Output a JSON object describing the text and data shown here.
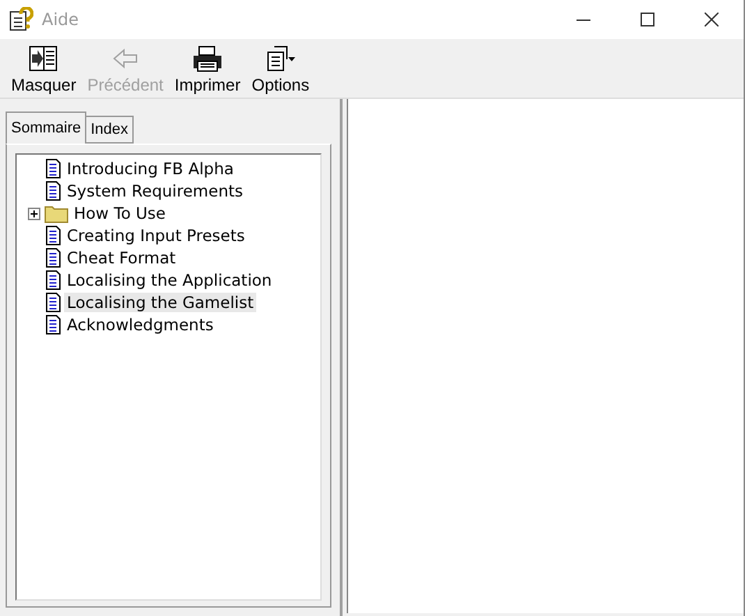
{
  "window": {
    "title": "Aide"
  },
  "toolbar": [
    {
      "kind": "hide",
      "label": "Masquer",
      "disabled": false
    },
    {
      "kind": "back",
      "label": "Précédent",
      "disabled": true
    },
    {
      "kind": "print",
      "label": "Imprimer",
      "disabled": false
    },
    {
      "kind": "options",
      "label": "Options",
      "disabled": false
    }
  ],
  "tabs": [
    {
      "label": "Sommaire",
      "selected": true
    },
    {
      "label": "Index",
      "selected": false
    }
  ],
  "tree": [
    {
      "kind": "page",
      "label": "Introducing FB Alpha",
      "selected": false
    },
    {
      "kind": "page",
      "label": "System Requirements",
      "selected": false
    },
    {
      "kind": "folder",
      "label": "How To Use",
      "selected": false,
      "expanded": false
    },
    {
      "kind": "page",
      "label": "Creating Input Presets",
      "selected": false
    },
    {
      "kind": "page",
      "label": "Cheat Format",
      "selected": false
    },
    {
      "kind": "page",
      "label": "Localising the Application",
      "selected": false
    },
    {
      "kind": "page",
      "label": "Localising the Gamelist",
      "selected": true
    },
    {
      "kind": "page",
      "label": "Acknowledgments",
      "selected": false
    }
  ]
}
